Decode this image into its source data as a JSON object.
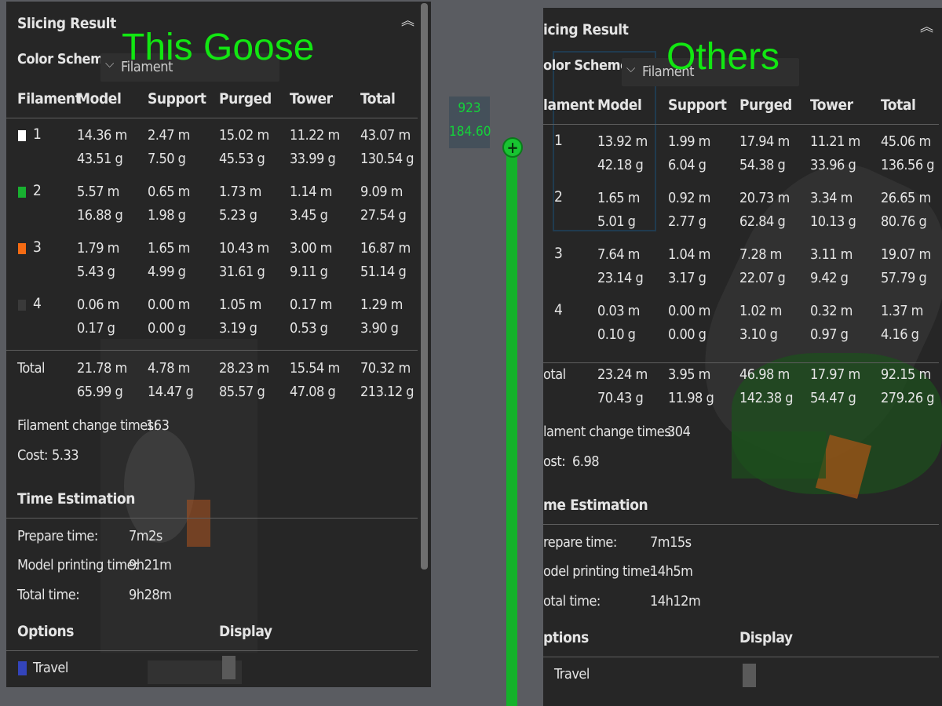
{
  "overlays": {
    "left": "This Goose",
    "right": "Others"
  },
  "slider": {
    "top_value": "923",
    "bottom_value": "184.60",
    "handle_glyph": "+"
  },
  "colors": {
    "filament_1": "#ffffff",
    "filament_2": "#18b030",
    "filament_3": "#f56b13",
    "filament_4": "#3a3a3a",
    "travel": "#3344bb",
    "accent_green": "#14e614"
  },
  "left": {
    "title": "Slicing Result",
    "collapse_icon": "chevron-up-double",
    "color_scheme_label": "Color Scheme",
    "color_scheme_value": "Filament",
    "headers": [
      "Filament",
      "Model",
      "Support",
      "Purged",
      "Tower",
      "Total"
    ],
    "rows": [
      {
        "id": "1",
        "model": [
          "14.36 m",
          "43.51 g"
        ],
        "support": [
          "2.47 m",
          "7.50 g"
        ],
        "purged": [
          "15.02 m",
          "45.53 g"
        ],
        "tower": [
          "11.22 m",
          "33.99 g"
        ],
        "total": [
          "43.07 m",
          "130.54 g"
        ]
      },
      {
        "id": "2",
        "model": [
          "5.57 m",
          "16.88 g"
        ],
        "support": [
          "0.65 m",
          "1.98 g"
        ],
        "purged": [
          "1.73 m",
          "5.23 g"
        ],
        "tower": [
          "1.14 m",
          "3.45 g"
        ],
        "total": [
          "9.09 m",
          "27.54 g"
        ]
      },
      {
        "id": "3",
        "model": [
          "1.79 m",
          "5.43 g"
        ],
        "support": [
          "1.65 m",
          "4.99 g"
        ],
        "purged": [
          "10.43 m",
          "31.61 g"
        ],
        "tower": [
          "3.00 m",
          "9.11 g"
        ],
        "total": [
          "16.87 m",
          "51.14 g"
        ]
      },
      {
        "id": "4",
        "model": [
          "0.06 m",
          "0.17 g"
        ],
        "support": [
          "0.00 m",
          "0.00 g"
        ],
        "purged": [
          "1.05 m",
          "3.19 g"
        ],
        "tower": [
          "0.17 m",
          "0.53 g"
        ],
        "total": [
          "1.29 m",
          "3.90 g"
        ]
      }
    ],
    "total_row": {
      "label": "Total",
      "model": [
        "21.78 m",
        "65.99 g"
      ],
      "support": [
        "4.78 m",
        "14.47 g"
      ],
      "purged": [
        "28.23 m",
        "85.57 g"
      ],
      "tower": [
        "15.54 m",
        "47.08 g"
      ],
      "total": [
        "70.32 m",
        "213.12 g"
      ]
    },
    "change_label": "Filament change times:",
    "change_value": "163",
    "cost_label": "Cost:",
    "cost_value": "5.33",
    "time_title": "Time Estimation",
    "prepare_label": "Prepare time:",
    "prepare_value": "7m2s",
    "model_time_label": "Model printing time:",
    "model_time_value": "9h21m",
    "total_time_label": "Total time:",
    "total_time_value": "9h28m",
    "options_label": "Options",
    "display_label": "Display",
    "travel_label": "Travel"
  },
  "right": {
    "title": "icing Result",
    "collapse_icon": "chevron-up-double",
    "color_scheme_label": "olor Scheme",
    "color_scheme_value": "Filament",
    "headers": [
      "lament",
      "Model",
      "Support",
      "Purged",
      "Tower",
      "Total"
    ],
    "rows": [
      {
        "id": "1",
        "model": [
          "13.92 m",
          "42.18 g"
        ],
        "support": [
          "1.99 m",
          "6.04 g"
        ],
        "purged": [
          "17.94 m",
          "54.38 g"
        ],
        "tower": [
          "11.21 m",
          "33.96 g"
        ],
        "total": [
          "45.06 m",
          "136.56 g"
        ]
      },
      {
        "id": "2",
        "model": [
          "1.65 m",
          "5.01 g"
        ],
        "support": [
          "0.92 m",
          "2.77 g"
        ],
        "purged": [
          "20.73 m",
          "62.84 g"
        ],
        "tower": [
          "3.34 m",
          "10.13 g"
        ],
        "total": [
          "26.65 m",
          "80.76 g"
        ]
      },
      {
        "id": "3",
        "model": [
          "7.64 m",
          "23.14 g"
        ],
        "support": [
          "1.04 m",
          "3.17 g"
        ],
        "purged": [
          "7.28 m",
          "22.07 g"
        ],
        "tower": [
          "3.11 m",
          "9.42 g"
        ],
        "total": [
          "19.07 m",
          "57.79 g"
        ]
      },
      {
        "id": "4",
        "model": [
          "0.03 m",
          "0.10 g"
        ],
        "support": [
          "0.00 m",
          "0.00 g"
        ],
        "purged": [
          "1.02 m",
          "3.10 g"
        ],
        "tower": [
          "0.32 m",
          "0.97 g"
        ],
        "total": [
          "1.37 m",
          "4.16 g"
        ]
      }
    ],
    "total_row": {
      "label": "otal",
      "model": [
        "23.24 m",
        "70.43 g"
      ],
      "support": [
        "3.95 m",
        "11.98 g"
      ],
      "purged": [
        "46.98 m",
        "142.38 g"
      ],
      "tower": [
        "17.97 m",
        "54.47 g"
      ],
      "total": [
        "92.15 m",
        "279.26 g"
      ]
    },
    "change_label": "lament change times:",
    "change_value": "304",
    "cost_label": "ost:",
    "cost_value": "6.98",
    "time_title": "me Estimation",
    "prepare_label": "repare time:",
    "prepare_value": "7m15s",
    "model_time_label": "odel printing time:",
    "model_time_value": "14h5m",
    "total_time_label": "otal time:",
    "total_time_value": "14h12m",
    "options_label": "ptions",
    "display_label": "Display",
    "travel_label": "Travel"
  }
}
